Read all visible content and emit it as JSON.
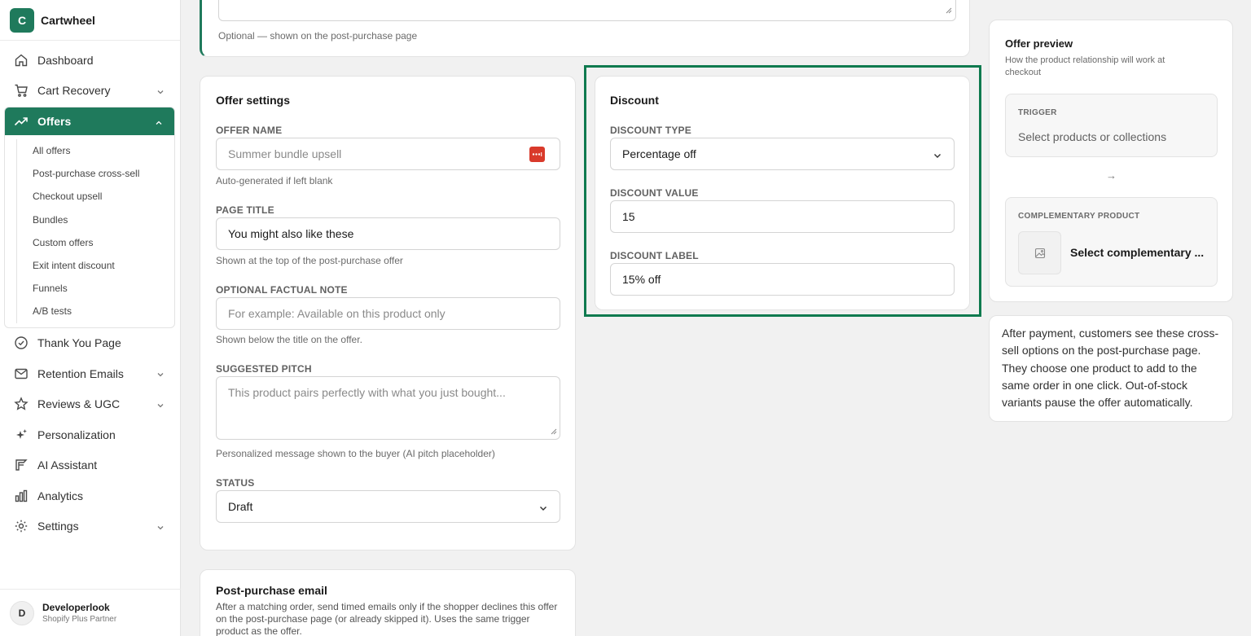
{
  "brand": {
    "logo_letter": "C",
    "name": "Cartwheel"
  },
  "nav": {
    "dashboard": "Dashboard",
    "cart_recovery": "Cart Recovery",
    "offers": "Offers",
    "offers_sub": [
      "All offers",
      "Post-purchase cross-sell",
      "Checkout upsell",
      "Bundles",
      "Custom offers",
      "Exit intent discount",
      "Funnels",
      "A/B tests"
    ],
    "thank_you": "Thank You Page",
    "retention": "Retention Emails",
    "reviews": "Reviews & UGC",
    "personalization": "Personalization",
    "ai_assistant": "AI Assistant",
    "analytics": "Analytics",
    "settings": "Settings"
  },
  "user": {
    "initial": "D",
    "name": "Developerlook",
    "role": "Shopify Plus Partner"
  },
  "top_card": {
    "help": "Optional — shown on the post-purchase page"
  },
  "offer_settings": {
    "title": "Offer settings",
    "offer_name_label": "OFFER NAME",
    "offer_name_placeholder": "Summer bundle upsell",
    "offer_name_help": "Auto-generated if left blank",
    "page_title_label": "PAGE TITLE",
    "page_title_value": "You might also like these",
    "page_title_help": "Shown at the top of the post-purchase offer",
    "factual_note_label": "OPTIONAL FACTUAL NOTE",
    "factual_note_placeholder": "For example: Available on this product only",
    "factual_note_help": "Shown below the title on the offer.",
    "pitch_label": "SUGGESTED PITCH",
    "pitch_placeholder": "This product pairs perfectly with what you just bought...",
    "pitch_help": "Personalized message shown to the buyer (AI pitch placeholder)",
    "status_label": "STATUS",
    "status_value": "Draft"
  },
  "discount": {
    "title": "Discount",
    "type_label": "DISCOUNT TYPE",
    "type_value": "Percentage off",
    "value_label": "DISCOUNT VALUE",
    "value": "15",
    "label_label": "DISCOUNT LABEL",
    "label_value": "15% off"
  },
  "email": {
    "title": "Post-purchase email",
    "desc": "After a matching order, send timed emails only if the shopper declines this offer on the post-purchase page (or already skipped it). Uses the same trigger product as the offer."
  },
  "preview": {
    "title": "Offer preview",
    "subtitle": "How the product relationship will work at checkout",
    "trigger_label": "TRIGGER",
    "trigger_value": "Select products or collections",
    "arrow": "→",
    "comp_label": "COMPLEMENTARY PRODUCT",
    "comp_value": "Select complementary ..."
  },
  "info": {
    "text": "After payment, customers see these cross-sell options on the post-purchase page. They choose one product to add to the same order in one click. Out-of-stock variants pause the offer automatically."
  },
  "colors": {
    "accent": "#1f7a5c",
    "highlight": "#0f7a4f"
  }
}
